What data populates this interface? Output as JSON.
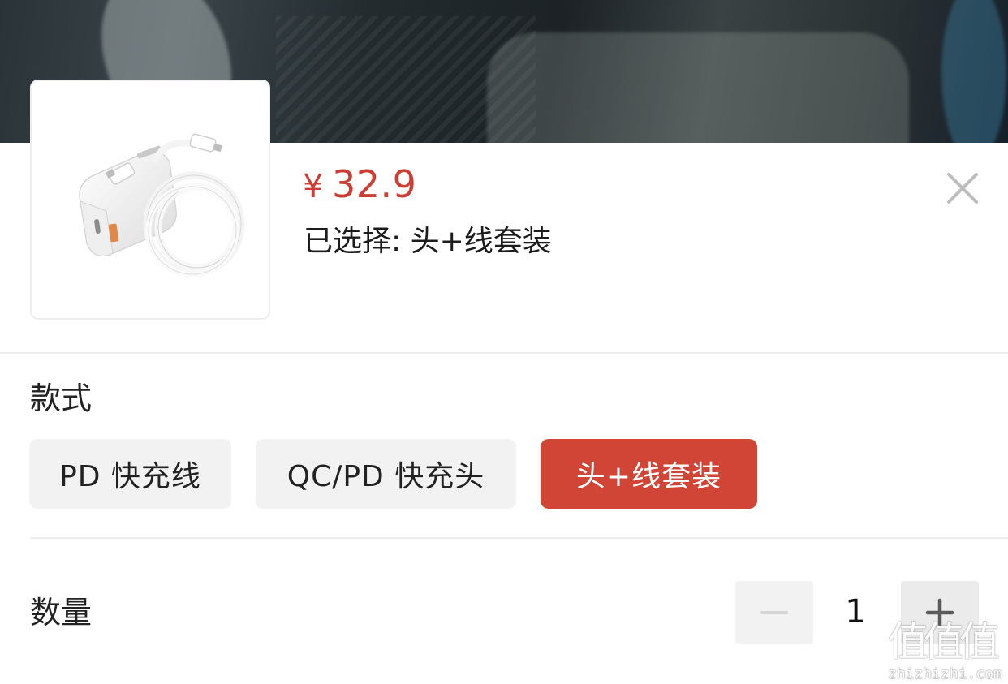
{
  "product": {
    "currency": "¥",
    "price": "32.9",
    "selected_text": "已选择: 头+线套装",
    "image_alt": "white charger with USB-C cable"
  },
  "style_section": {
    "label": "款式",
    "options": [
      {
        "label": "PD 快充线",
        "selected": false
      },
      {
        "label": "QC/PD 快充头",
        "selected": false
      },
      {
        "label": "头+线套装",
        "selected": true
      }
    ]
  },
  "quantity_section": {
    "label": "数量",
    "value": "1",
    "minus_label": "−",
    "plus_label": "+"
  },
  "colors": {
    "accent": "#d04536",
    "price": "#cc3d33",
    "option_bg": "#f2f2f2"
  },
  "icons": {
    "close": "close-icon",
    "minus": "minus-icon",
    "plus": "plus-icon"
  },
  "watermark": {
    "glyphs": "值值值",
    "url": "zhizhizhi.com"
  }
}
